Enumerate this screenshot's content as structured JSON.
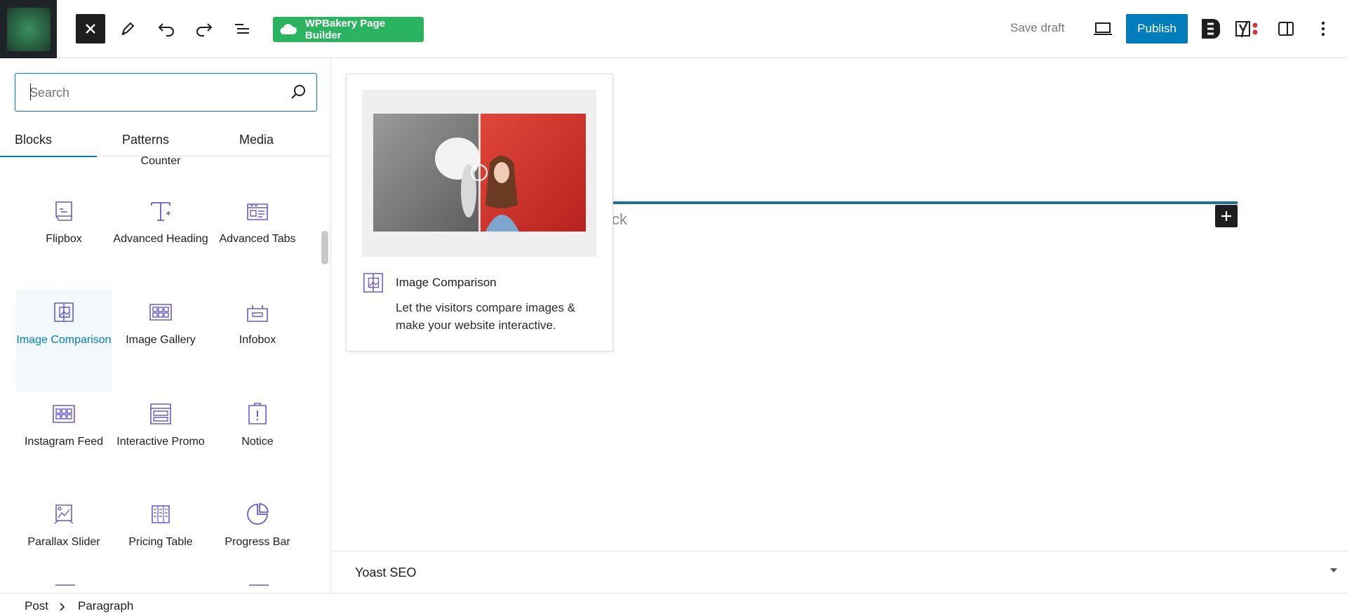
{
  "toolbar": {
    "wpbakery_label": "WPBakery Page Builder",
    "save_draft_label": "Save draft",
    "publish_label": "Publish",
    "icons": [
      "site-logo",
      "close-icon",
      "pencil-icon",
      "undo-icon",
      "redo-icon",
      "list-view-icon",
      "cloud-icon",
      "desktop-preview-icon",
      "elementor-icon",
      "yoast-icon",
      "sidebar-toggle-icon",
      "more-options-icon"
    ]
  },
  "inserter": {
    "search_placeholder": "Search",
    "tabs": [
      {
        "label": "Blocks",
        "active": true
      },
      {
        "label": "Patterns",
        "active": false
      },
      {
        "label": "Media",
        "active": false
      }
    ],
    "partial_label": "Counter",
    "blocks": [
      {
        "label": "Flipbox",
        "icon": "flipbox-icon"
      },
      {
        "label": "Advanced Heading",
        "icon": "advanced-heading-icon"
      },
      {
        "label": "Advanced Tabs",
        "icon": "advanced-tabs-icon"
      },
      {
        "label": "Image Comparison",
        "icon": "image-comparison-icon",
        "selected": true
      },
      {
        "label": "Image Gallery",
        "icon": "image-gallery-icon"
      },
      {
        "label": "Infobox",
        "icon": "infobox-icon"
      },
      {
        "label": "Instagram Feed",
        "icon": "instagram-feed-icon"
      },
      {
        "label": "Interactive Promo",
        "icon": "interactive-promo-icon"
      },
      {
        "label": "Notice",
        "icon": "notice-icon"
      },
      {
        "label": "Parallax Slider",
        "icon": "parallax-slider-icon"
      },
      {
        "label": "Pricing Table",
        "icon": "pricing-table-icon"
      },
      {
        "label": "Progress Bar",
        "icon": "progress-bar-icon"
      }
    ]
  },
  "preview": {
    "title": "Image Comparison",
    "description": "Let the visitors compare images & make your website interactive."
  },
  "canvas": {
    "ghost_text": "ck"
  },
  "yoast": {
    "label": "Yoast SEO"
  },
  "breadcrumb": {
    "items": [
      "Post",
      "Paragraph"
    ]
  },
  "colors": {
    "accent": "#007cba",
    "wpbakery_green": "#2ab460",
    "block_icon_purple": "#6a5acd",
    "dark": "#1e1e1e"
  }
}
